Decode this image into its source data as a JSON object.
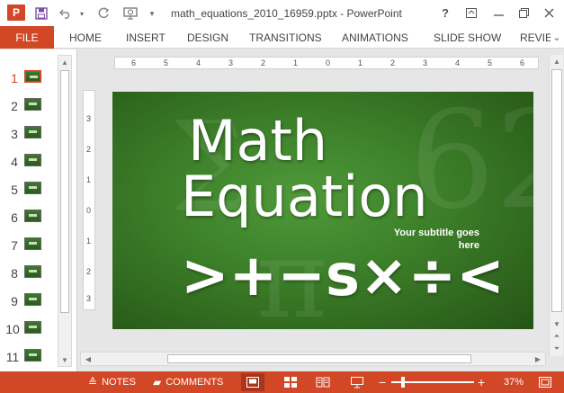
{
  "titlebar": {
    "app_logo": "P",
    "document_title": "math_equations_2010_16959.pptx - PowerPoint",
    "help": "?",
    "quick_access": {
      "save_icon": "save-icon",
      "undo_icon": "undo-icon",
      "redo_icon": "redo-icon",
      "start_icon": "start-from-beginning-icon",
      "customize_icon": "customize-qat-icon"
    },
    "window_controls": [
      "ribbon-display-icon",
      "minimize-icon",
      "restore-icon",
      "close-icon"
    ]
  },
  "ribbon": {
    "file_label": "FILE",
    "tabs": [
      "HOME",
      "INSERT",
      "DESIGN",
      "TRANSITIONS",
      "ANIMATIONS",
      "SLIDE SHOW",
      "REVIEW"
    ]
  },
  "thumbnails": {
    "selected": 1,
    "slide_numbers": [
      "1",
      "2",
      "3",
      "4",
      "5",
      "6",
      "7",
      "8",
      "9",
      "10",
      "11"
    ]
  },
  "rulers": {
    "horizontal": [
      "6",
      "5",
      "4",
      "3",
      "2",
      "1",
      "0",
      "1",
      "2",
      "3",
      "4",
      "5",
      "6"
    ],
    "vertical": [
      "3",
      "2",
      "1",
      "0",
      "1",
      "2",
      "3"
    ]
  },
  "slide": {
    "title_line1": "Math",
    "title_line2": "Equation",
    "subtitle_line1": "Your subtitle goes",
    "subtitle_line2": "here",
    "symbols": ">+−s×÷<",
    "background_colors": [
      "#4f9a3a",
      "#3b7d28",
      "#255416"
    ]
  },
  "statusbar": {
    "notes_label": "NOTES",
    "comments_label": "COMMENTS",
    "zoom_minus": "−",
    "zoom_plus": "+",
    "zoom_level": "37%"
  },
  "colors": {
    "accent": "#d24726",
    "ribbon_bg": "#ffffff",
    "workspace": "#e6e6e6"
  }
}
